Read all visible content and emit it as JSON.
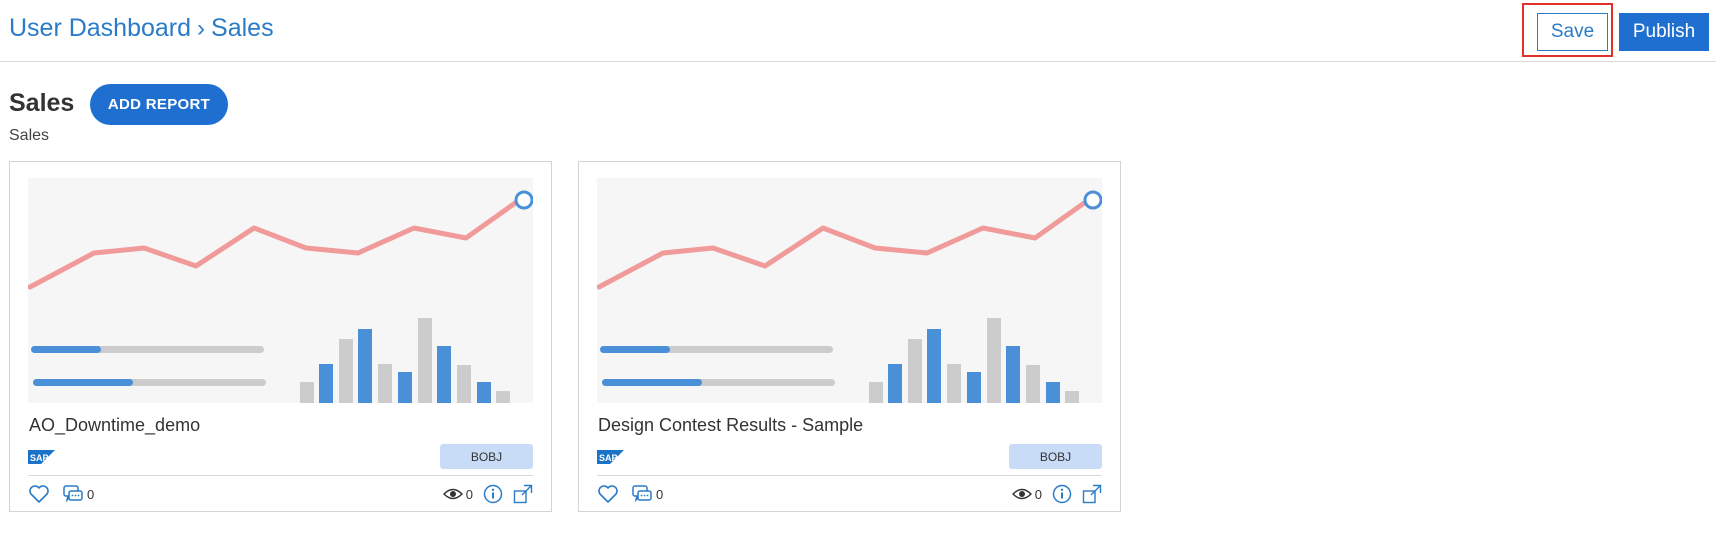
{
  "header": {
    "breadcrumb": {
      "parent": "User Dashboard",
      "separator": "›",
      "current": "Sales"
    },
    "save_label": "Save",
    "publish_label": "Publish"
  },
  "section": {
    "title": "Sales",
    "subtitle": "Sales",
    "add_report_label": "ADD REPORT"
  },
  "cards": [
    {
      "title": "AO_Downtime_demo",
      "badge": "BOBJ",
      "comments": "0",
      "views": "0"
    },
    {
      "title": "Design Contest Results - Sample",
      "badge": "BOBJ",
      "comments": "0",
      "views": "0"
    }
  ],
  "colors": {
    "accent": "#1f6fd0",
    "link": "#2a7bc8",
    "highlight": "#e0322b",
    "badge_bg": "#c9dcf7",
    "thumb_line": "#f19a9a",
    "thumb_bar_blue": "#4a90d9",
    "thumb_bar_gray": "#cccccc"
  },
  "icons": [
    "heart-icon",
    "comment-icon",
    "eye-icon",
    "info-icon",
    "expand-icon",
    "sap-logo"
  ]
}
